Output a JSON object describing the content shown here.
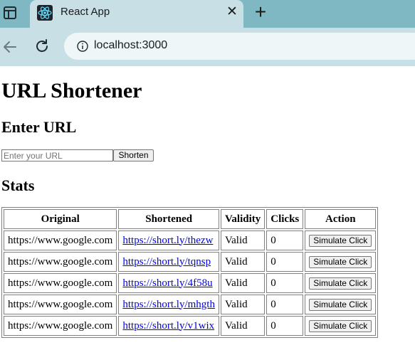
{
  "browser": {
    "tab_title": "React App",
    "address": "localhost:3000"
  },
  "page": {
    "title": "URL Shortener",
    "enter_heading": "Enter URL",
    "input_placeholder": "Enter your URL",
    "input_value": "",
    "shorten_label": "Shorten",
    "stats_heading": "Stats",
    "table": {
      "headers": [
        "Original",
        "Shortened",
        "Validity",
        "Clicks",
        "Action"
      ],
      "rows": [
        {
          "original": "https://www.google.com",
          "shortened": "https://short.ly/thezw",
          "validity": "Valid",
          "clicks": "0",
          "action": "Simulate Click"
        },
        {
          "original": "https://www.google.com",
          "shortened": "https://short.ly/tqnsp",
          "validity": "Valid",
          "clicks": "0",
          "action": "Simulate Click"
        },
        {
          "original": "https://www.google.com",
          "shortened": "https://short.ly/4f58u",
          "validity": "Valid",
          "clicks": "0",
          "action": "Simulate Click"
        },
        {
          "original": "https://www.google.com",
          "shortened": "https://short.ly/mhgth",
          "validity": "Valid",
          "clicks": "0",
          "action": "Simulate Click"
        },
        {
          "original": "https://www.google.com",
          "shortened": "https://short.ly/v1wix",
          "validity": "Valid",
          "clicks": "0",
          "action": "Simulate Click"
        }
      ]
    }
  },
  "colors": {
    "tabbar": "#7fb7c2",
    "toolbar": "#c8e0e5",
    "link": "#0000ee"
  },
  "icons": [
    "sidebar-toggle-icon",
    "react-favicon-icon",
    "close-icon",
    "plus-icon",
    "back-arrow-icon",
    "reload-icon",
    "info-icon"
  ]
}
